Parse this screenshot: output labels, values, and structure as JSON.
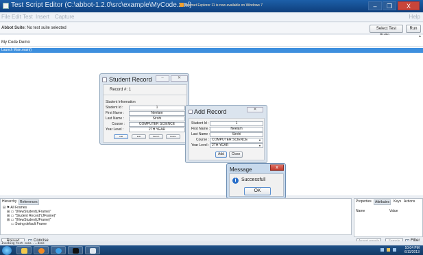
{
  "window": {
    "title": "Test Script Editor (C:\\abbot-1.2.0\\src\\example\\MyCode.xml)",
    "notice": "Internet Explorer 11 is now available on Windows 7",
    "min_glyph": "–",
    "max_glyph": "❐",
    "close_glyph": "X"
  },
  "menu": {
    "file": "File",
    "edit": "Edit",
    "test": "Test",
    "insert": "Insert",
    "capture": "Capture",
    "help": "Help"
  },
  "suite": {
    "label_bold": "Abbot Suite:",
    "label_text": "No test suite selected",
    "select_button": "Select Test Suite...",
    "run_button": "Run"
  },
  "script": {
    "name": "My Code Demo",
    "highlight_line": "Launch Main.main()"
  },
  "student_record": {
    "title": "Student Record",
    "record_no": "Record #: 1",
    "section": "Student Information",
    "fields": [
      {
        "label": "Student Id :",
        "value": "1"
      },
      {
        "label": "First Name :",
        "value": "Neelam"
      },
      {
        "label": "Last Name :",
        "value": "Sirohi"
      },
      {
        "label": "Course :",
        "value": "COMPUTER SCIENCE"
      },
      {
        "label": "Year Level :",
        "value": "2TH YEAR"
      }
    ],
    "buttons": [
      "Add",
      "Edit",
      "Search",
      "Delete"
    ]
  },
  "add_record": {
    "title": "Add Record",
    "fields": [
      {
        "label": "Student Id :",
        "value": "1"
      },
      {
        "label": "First Name :",
        "value": "Neelam"
      },
      {
        "label": "Last Name :",
        "value": "Sirohi"
      },
      {
        "label": "Course :",
        "value": "COMPUTER SCIENCE"
      },
      {
        "label": "Year Level :",
        "value": "2TH YEAR"
      }
    ],
    "add_button": "Add",
    "close_button": "Close"
  },
  "message": {
    "title": "Message",
    "text": "Successfull",
    "ok_button": "OK"
  },
  "hierarchy": {
    "tabs": [
      "Hierarchy",
      "References"
    ],
    "tree": [
      "All Frames",
      "\"(NewStudent)JFrame)\"",
      "\"Student Record\"(JFrame)\"",
      "\"(NewStudent)JFrame)\"",
      "Swing default Frame"
    ]
  },
  "properties": {
    "tabs": [
      "Properties",
      "Attributes",
      "Keys",
      "Actions"
    ],
    "col_name": "Name",
    "col_value": "Value",
    "assert_button": "Assert equals",
    "sample_button": "Sample",
    "filter_label": "Filter"
  },
  "bottom": {
    "reload_button": "Reload",
    "concise_label": "Concise",
    "status_text": "Invoking test case....done"
  },
  "taskbar": {
    "time": "10:04 PM",
    "date": "6/11/2013"
  },
  "colors": {
    "titlebar": "#1d5fa8",
    "highlight": "#3d8fde",
    "taskbar": "#1e5087",
    "close": "#c8453a"
  }
}
